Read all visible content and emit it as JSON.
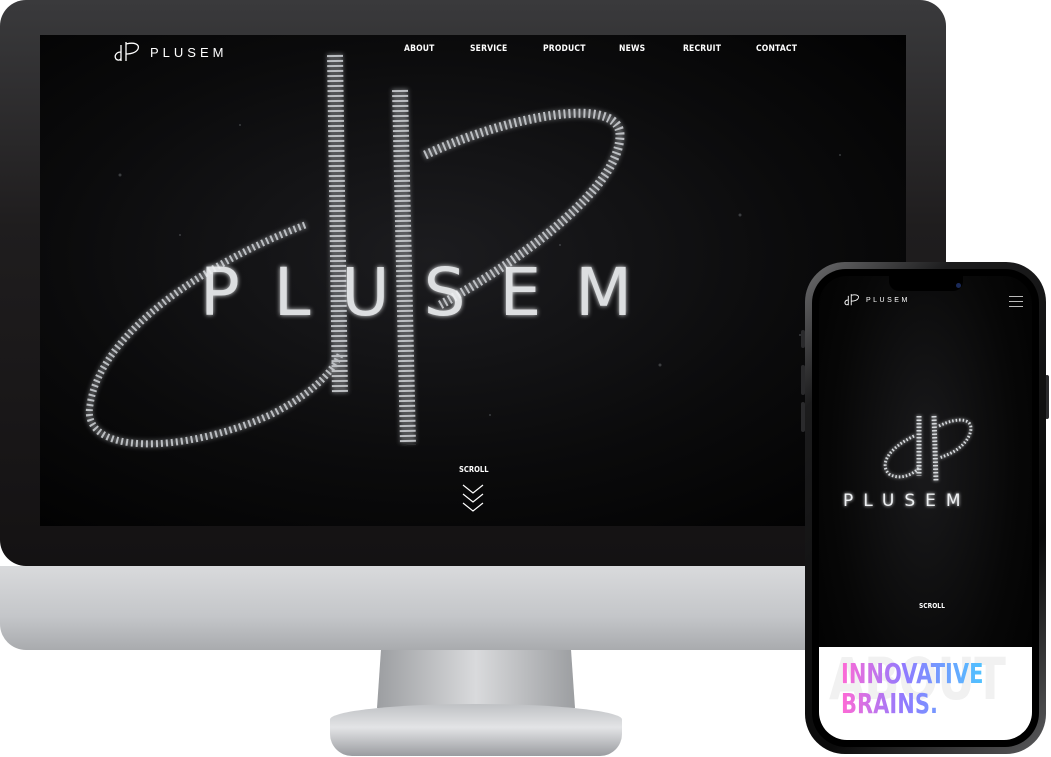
{
  "desktop": {
    "logo_text": "PLUSEM",
    "nav": [
      "ABOUT",
      "SERVICE",
      "PRODUCT",
      "NEWS",
      "RECRUIT",
      "CONTACT"
    ],
    "hero_logo_text": "PLUSEM",
    "scroll_label": "SCROLL"
  },
  "mobile": {
    "logo_text": "PLUSEM",
    "hero_logo_text": "PLUSEM",
    "scroll_label": "SCROLL",
    "about_bg_text": "ABOUT",
    "tagline_line1": "INNOVATIVE",
    "tagline_line2": "BRAINS."
  },
  "colors": {
    "background": "#000000",
    "text": "#ffffff",
    "tagline_gradient": [
      "#ff6ad5",
      "#8f7bff",
      "#4fc3ff"
    ]
  },
  "icons": [
    "logo-mark-icon",
    "scroll-chevrons-icon",
    "hamburger-menu-icon"
  ]
}
